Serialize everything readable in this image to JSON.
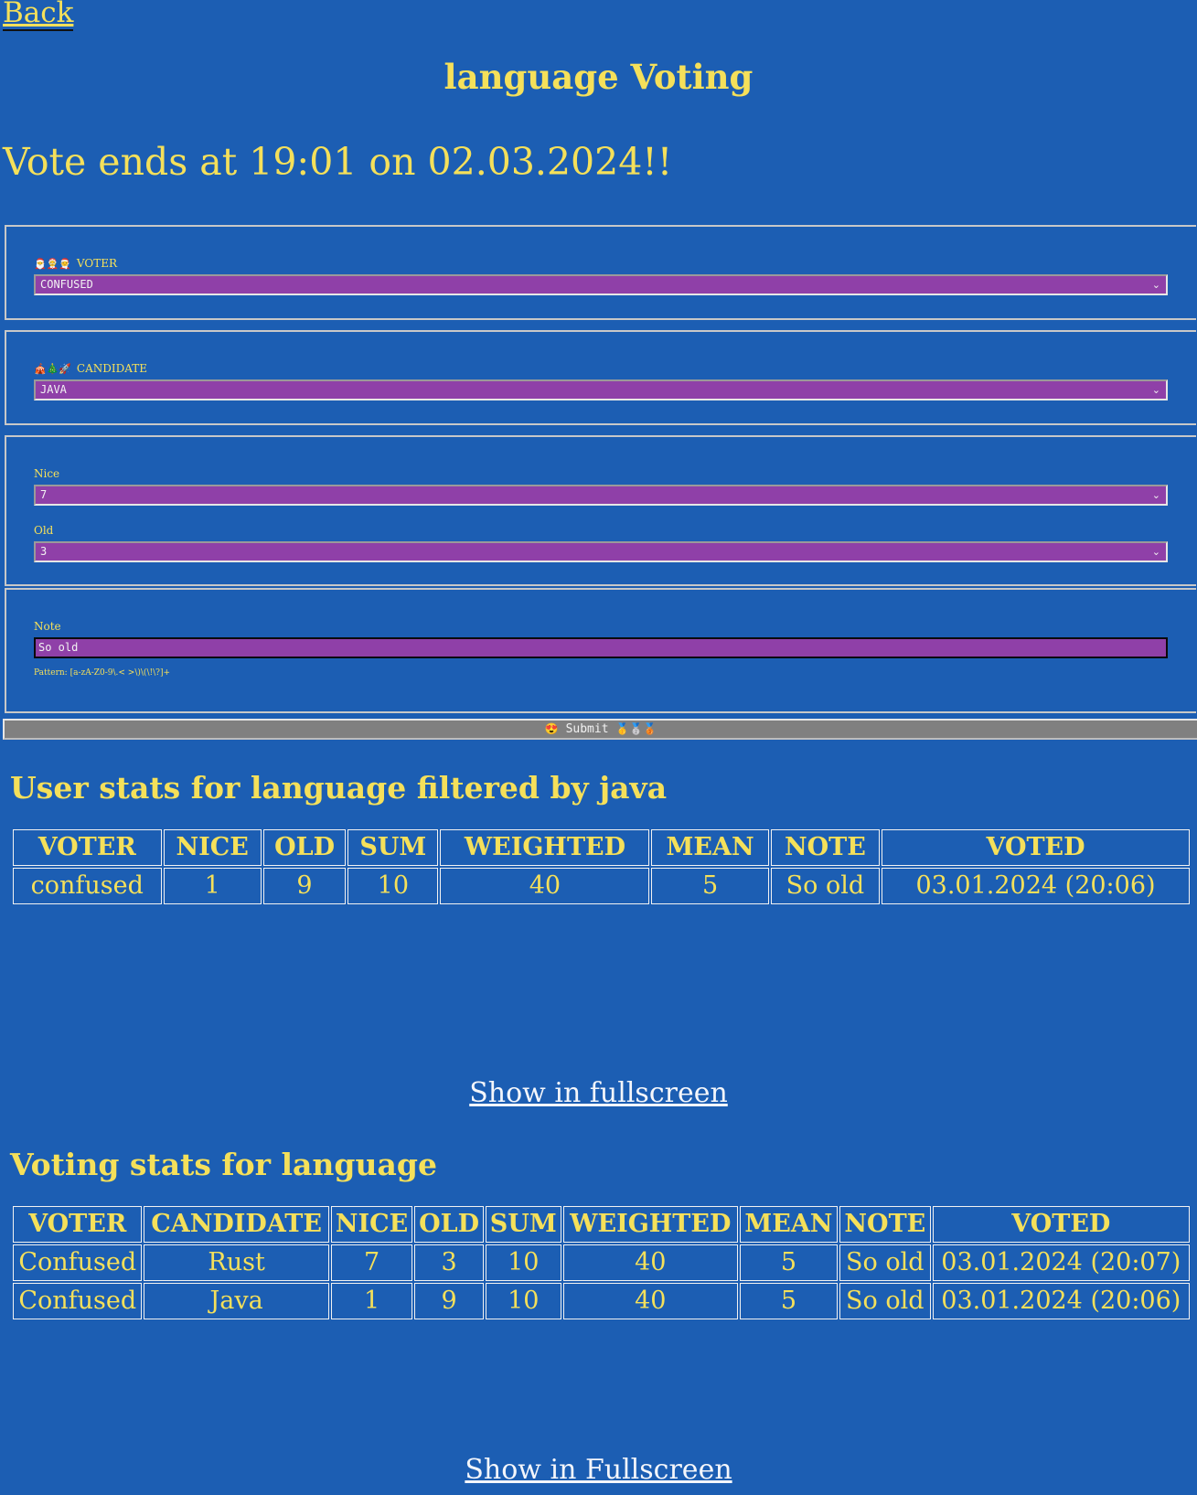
{
  "nav": {
    "back_label": "Back"
  },
  "header": {
    "title": "language Voting",
    "deadline_text": "Vote ends at 19:01 on 02.03.2024!!"
  },
  "form": {
    "voter": {
      "emojis": "🎅🤶🧑‍🎄",
      "label": "VOTER",
      "value": "CONFUSED"
    },
    "candidate": {
      "emojis": "🎪🎄🚀",
      "label": "CANDIDATE",
      "value": "JAVA"
    },
    "nice": {
      "label": "Nice",
      "value": "7"
    },
    "old": {
      "label": "Old",
      "value": "3"
    },
    "note": {
      "label": "Note",
      "value": "So old",
      "pattern_hint": "Pattern: [a-zA-Z0-9\\.< >\\)\\(\\!\\?]+"
    },
    "submit": {
      "prefix_emoji": "😍",
      "label": "Submit",
      "suffix_emojis": "🥇🥈🥉"
    }
  },
  "user_stats": {
    "heading": "User stats for language filtered by java",
    "columns": [
      "VOTER",
      "NICE",
      "OLD",
      "SUM",
      "WEIGHTED",
      "MEAN",
      "NOTE",
      "VOTED"
    ],
    "rows": [
      [
        "confused",
        "1",
        "9",
        "10",
        "40",
        "5",
        "So old",
        "03.01.2024 (20:06)"
      ]
    ],
    "fullscreen_link": "Show in fullscreen"
  },
  "voting_stats": {
    "heading": "Voting stats for language",
    "columns": [
      "VOTER",
      "CANDIDATE",
      "NICE",
      "OLD",
      "SUM",
      "WEIGHTED",
      "MEAN",
      "NOTE",
      "VOTED"
    ],
    "rows": [
      [
        "Confused",
        "Rust",
        "7",
        "3",
        "10",
        "40",
        "5",
        "So old",
        "03.01.2024 (20:07)"
      ],
      [
        "Confused",
        "Java",
        "1",
        "9",
        "10",
        "40",
        "5",
        "So old",
        "03.01.2024 (20:06)"
      ]
    ],
    "fullscreen_link": "Show in Fullscreen"
  },
  "colors": {
    "background": "#1c5eb3",
    "text": "#f5e05a",
    "field": "#8f40a8",
    "button": "#808080",
    "link": "#f4f6fb"
  }
}
